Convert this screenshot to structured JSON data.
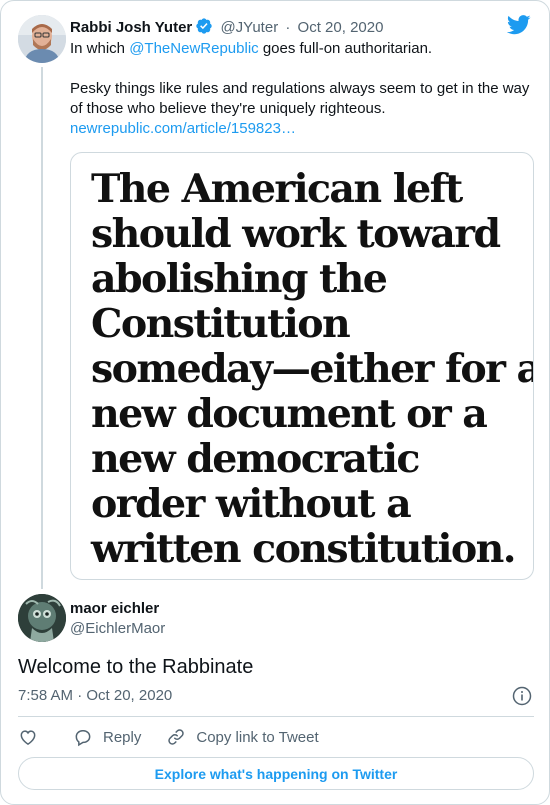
{
  "quoted_tweet": {
    "author_name": "Rabbi Josh Yuter",
    "verified": true,
    "handle": "@JYuter",
    "separator": "·",
    "date": "Oct 20, 2020",
    "text_line1_prefix": "In which ",
    "mention": "@TheNewRepublic",
    "text_line1_suffix": " goes full-on authoritarian.",
    "text_paragraph2": "Pesky things like rules and regulations always seem to get in the way of those who believe they're uniquely righteous.",
    "link": "newrepublic.com/article/159823…",
    "image_headline_lines": [
      "The American left",
      "should work toward",
      "abolishing the",
      "Constitution",
      "someday—either for a",
      "new document or a",
      "new democratic",
      "order without a",
      "written constitution."
    ]
  },
  "main_tweet": {
    "author_name": "maor eichler",
    "handle": "@EichlerMaor",
    "text": "Welcome to the Rabbinate",
    "timestamp": "7:58 AM · Oct 20, 2020"
  },
  "actions": {
    "reply_label": "Reply",
    "copy_link_label": "Copy link to Tweet"
  },
  "explore_button_label": "Explore what's happening on Twitter",
  "colors": {
    "accent": "#1d9bf0",
    "text": "#0f1419",
    "secondary_text": "#536471",
    "border": "#cfd9de"
  },
  "icons": {
    "verified": "verified-badge-icon",
    "logo": "twitter-bird-icon",
    "info": "info-icon",
    "like": "heart-icon",
    "reply": "reply-bubble-icon",
    "copy_link": "link-icon"
  }
}
